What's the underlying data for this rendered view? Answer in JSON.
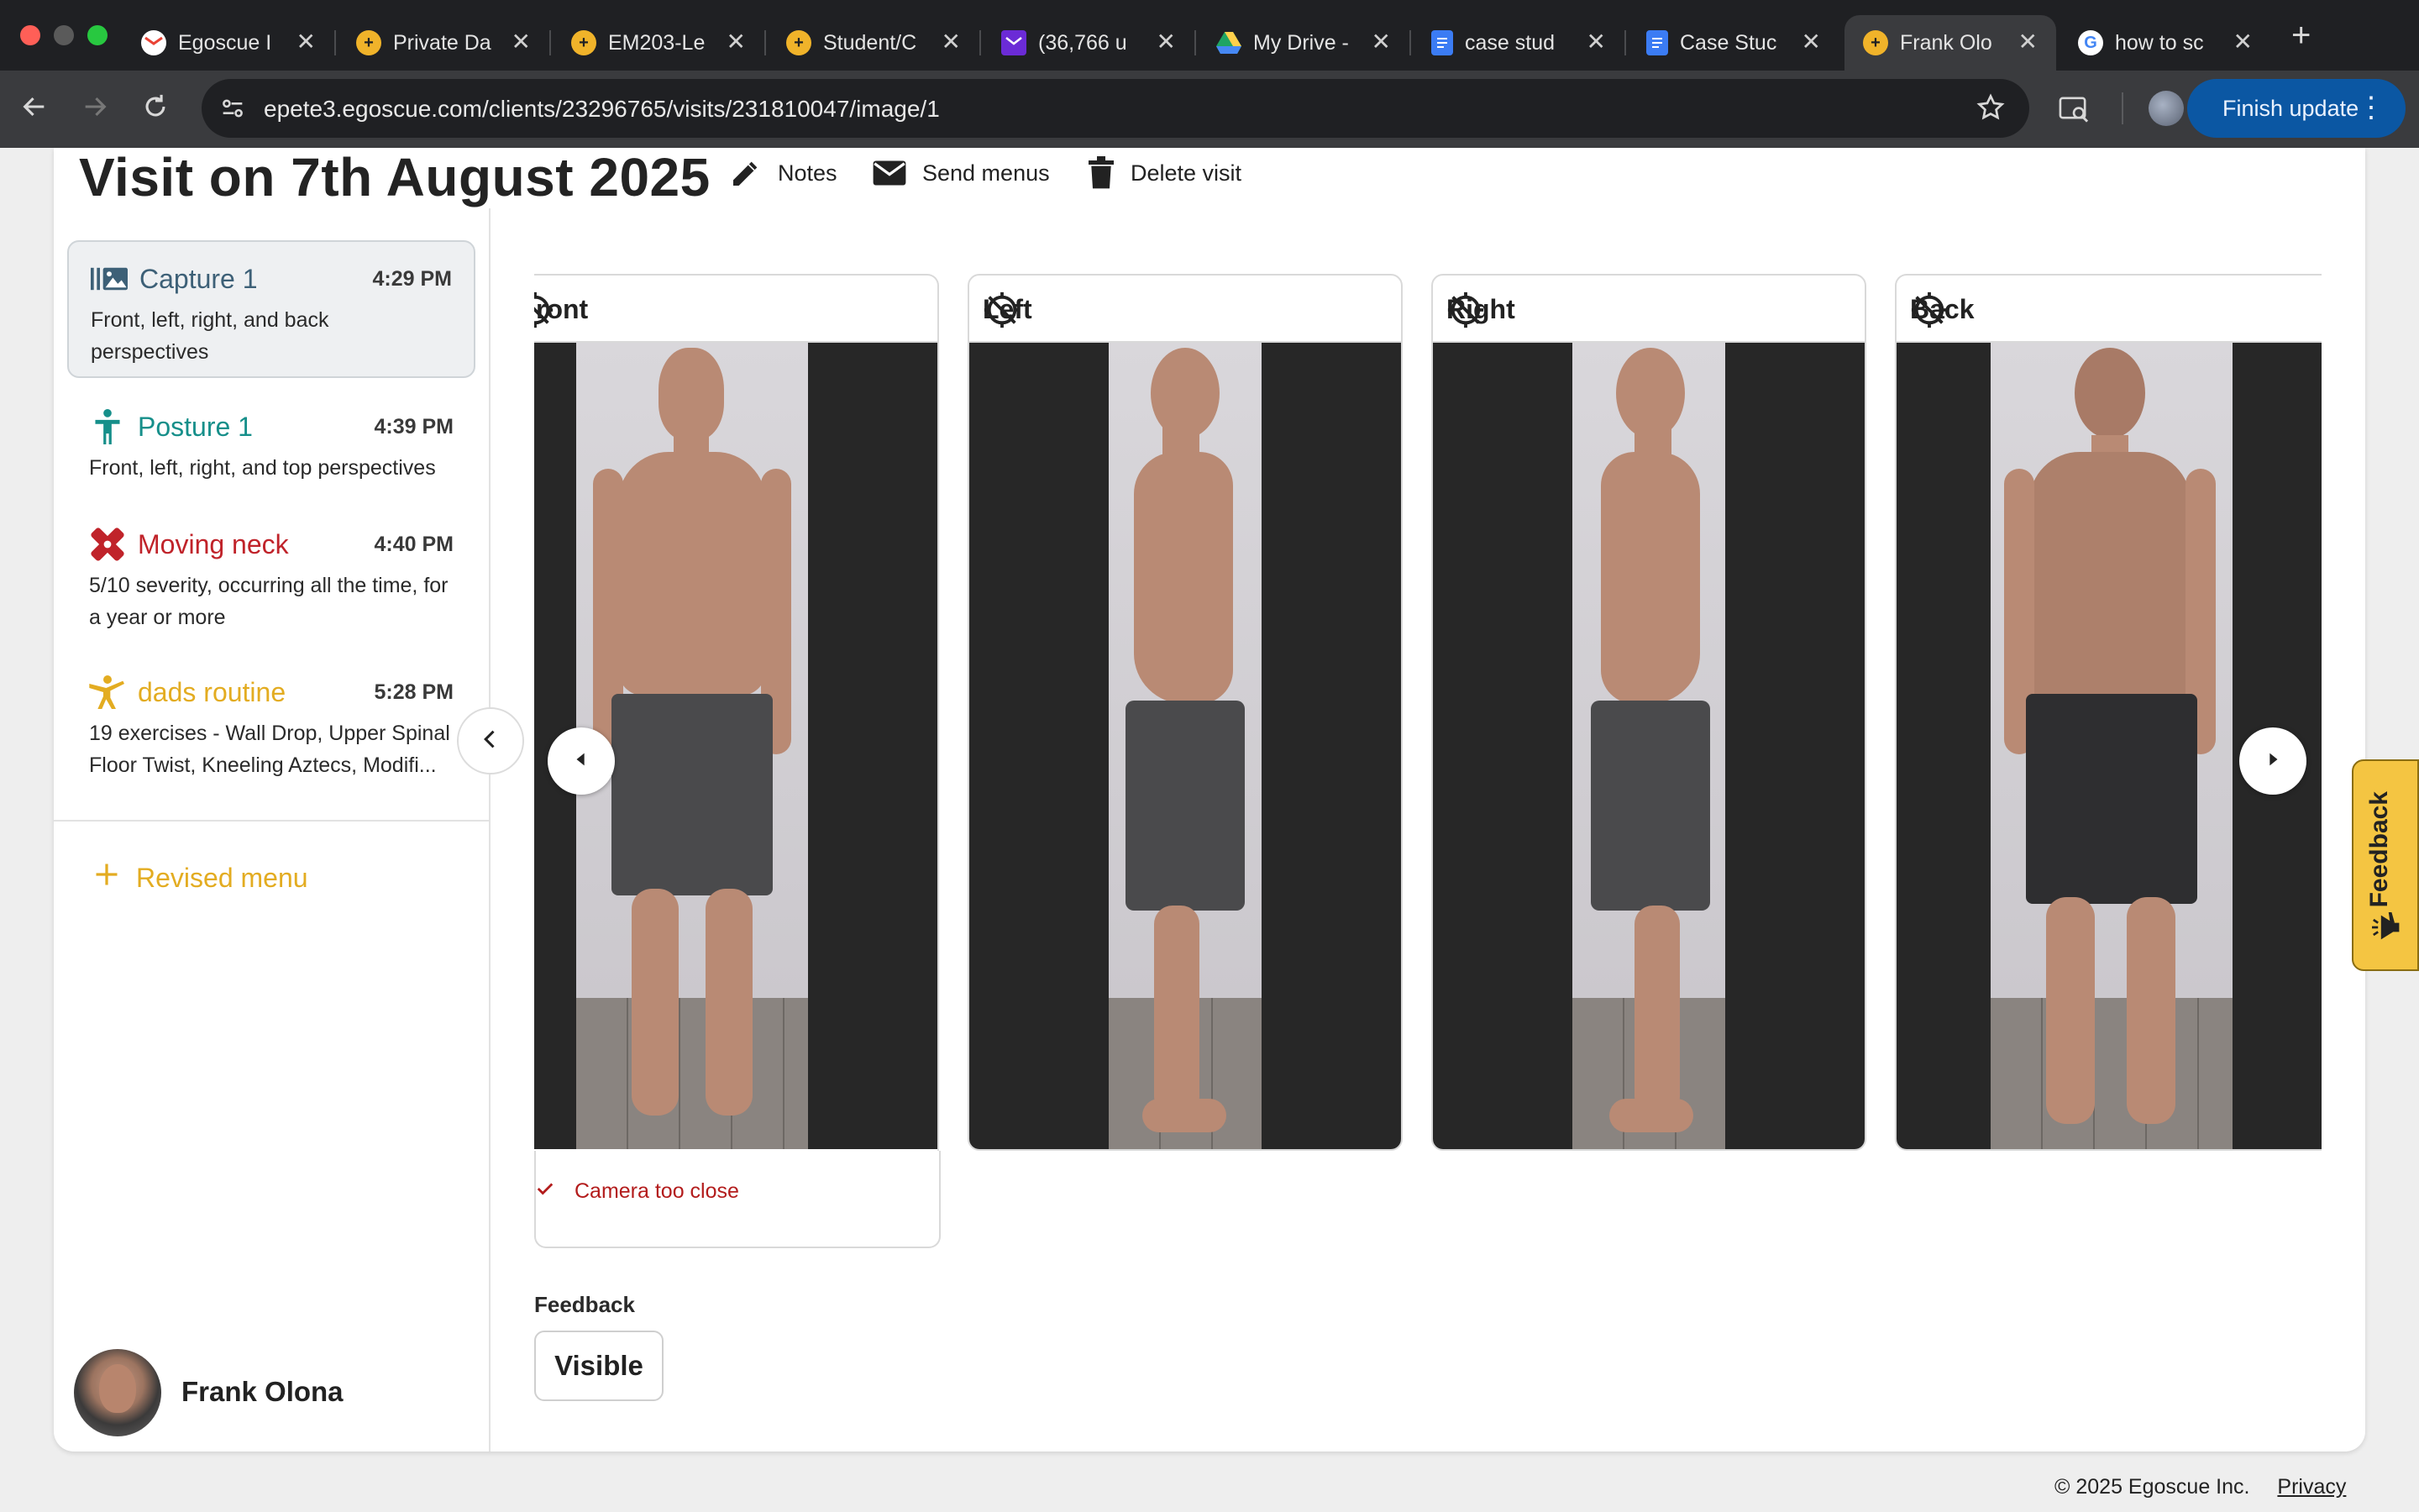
{
  "browser": {
    "tabs": [
      {
        "title": "Egoscue I",
        "icon": "gmail-icon",
        "color": "#ea4335"
      },
      {
        "title": "Private Da",
        "icon": "egoscue-icon",
        "color": "#f0b32a"
      },
      {
        "title": "EM203-Le",
        "icon": "egoscue-icon",
        "color": "#f0b32a"
      },
      {
        "title": "Student/C",
        "icon": "egoscue-icon",
        "color": "#f0b32a"
      },
      {
        "title": "(36,766 u",
        "icon": "yahoo-mail-icon",
        "color": "#6b2bd6"
      },
      {
        "title": "My Drive -",
        "icon": "google-drive-icon",
        "color": "#f4b400"
      },
      {
        "title": "case stud",
        "icon": "google-docs-icon",
        "color": "#3b7cf4"
      },
      {
        "title": "Case Stuc",
        "icon": "google-docs-icon",
        "color": "#3b7cf4"
      },
      {
        "title": "Frank Olo",
        "icon": "egoscue-icon",
        "color": "#f0b32a"
      },
      {
        "title": "how to sc",
        "icon": "google-icon",
        "color": "#ffffff"
      }
    ],
    "active_tab": 8,
    "url": "epete3.egoscue.com/clients/23296765/visits/231810047/image/1",
    "finish_update": "Finish update"
  },
  "visit": {
    "title": "Visit on 7th August 2025",
    "actions": {
      "notes": "Notes",
      "send_menus": "Send menus",
      "delete_visit": "Delete visit"
    }
  },
  "sidebar": {
    "items": [
      {
        "name": "Capture 1",
        "time": "4:29 PM",
        "desc": "Front, left, right, and back perspectives",
        "color": "#3d6077",
        "icon": "capture-icon",
        "selected": true
      },
      {
        "name": "Posture 1",
        "time": "4:39 PM",
        "desc": "Front, left, right, and top perspectives",
        "color": "#168f8a",
        "icon": "posture-icon",
        "selected": false
      },
      {
        "name": "Moving neck",
        "time": "4:40 PM",
        "desc": "5/10 severity, occurring all the time, for a year or more",
        "color": "#c0232a",
        "icon": "bandage-icon",
        "selected": false
      },
      {
        "name": "dads routine",
        "time": "5:28 PM",
        "desc": "19 exercises - Wall Drop, Upper Spinal Floor Twist, Kneeling Aztecs, Modifi...",
        "color": "#e3ac21",
        "icon": "exercise-icon",
        "selected": false
      }
    ],
    "revised_menu": "Revised menu",
    "user_name": "Frank Olona"
  },
  "photos": [
    {
      "label": "ront",
      "view": "front"
    },
    {
      "label": "Left",
      "view": "left"
    },
    {
      "label": "Right",
      "view": "right"
    },
    {
      "label": "Back",
      "view": "back"
    }
  ],
  "photo_notice": "Camera too close",
  "feedback": {
    "label": "Feedback",
    "value": "Visible",
    "side_tab": "Feedback"
  },
  "footer": {
    "copyright": "© 2025 Egoscue Inc.",
    "privacy": "Privacy"
  },
  "colors": {
    "accent_blue": "#0b57a3",
    "warning_red": "#b31c1c",
    "brand_yellow": "#e3ac21"
  }
}
